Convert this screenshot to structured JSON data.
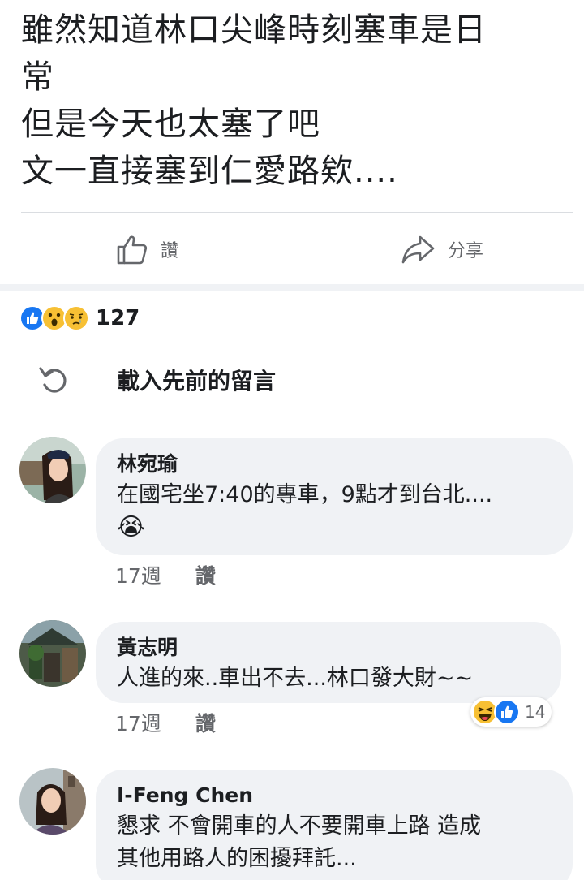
{
  "post": {
    "lines": [
      "雖然知道林口尖峰時刻塞車是日",
      "常",
      "但是今天也太塞了吧",
      "文一直接塞到仁愛路欸...."
    ]
  },
  "actions": {
    "like_label": "讚",
    "share_label": "分享"
  },
  "reactions": {
    "icons": [
      "like-icon",
      "wow-icon",
      "sad-icon"
    ],
    "count": "127"
  },
  "load_previous": {
    "label": "載入先前的留言",
    "icon": "refresh-icon"
  },
  "comments": [
    {
      "name": "林宛瑜",
      "text_lines": [
        "在國宅坐7:40的專車，9點才到台北....",
        "😭"
      ],
      "time": "17週",
      "like_label": "讚"
    },
    {
      "name": "黃志明",
      "text_lines": [
        "人進的來..車出不去...林口發大財~~"
      ],
      "time": "17週",
      "like_label": "讚",
      "reaction_icons": [
        "haha-icon",
        "like-icon"
      ],
      "reaction_count": "14"
    },
    {
      "name": "I-Feng Chen",
      "text_lines": [
        "懇求 不會開車的人不要開車上路 造成",
        "其他用路人的困擾拜託..."
      ]
    }
  ],
  "colors": {
    "like_blue": "#1877f2",
    "emoji_yellow": "#f7c034",
    "bubble_gray": "#f0f2f5",
    "meta_gray": "#65676b"
  }
}
